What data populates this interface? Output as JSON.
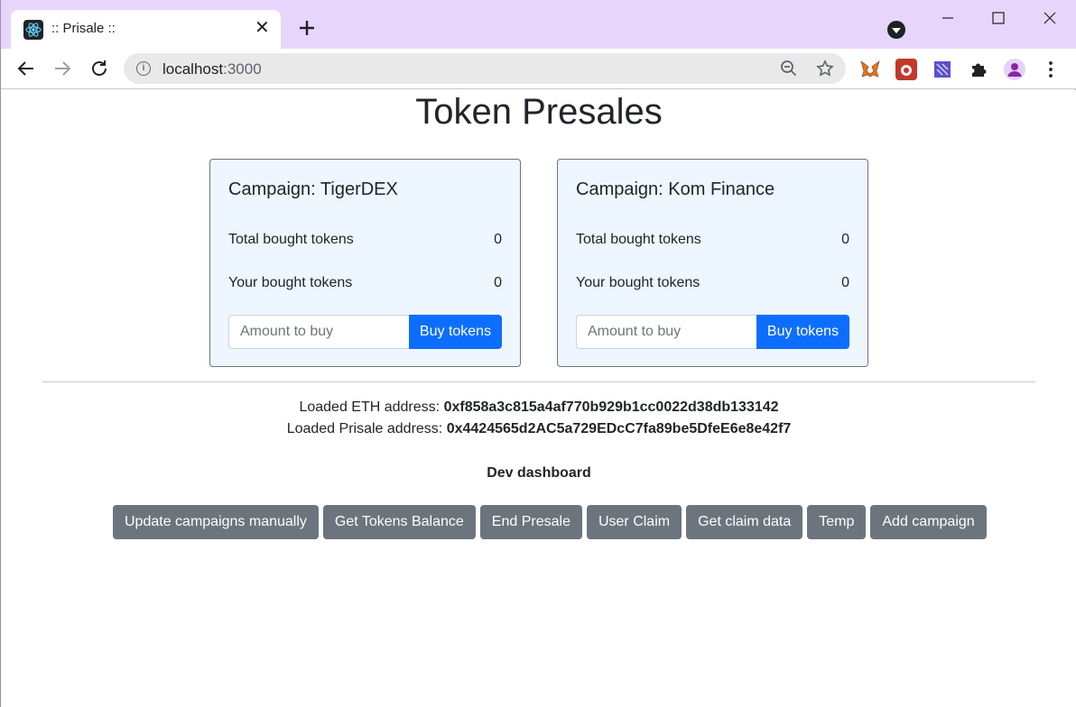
{
  "browser": {
    "tab_title": ":: Prisale ::",
    "url_host": "localhost",
    "url_port": ":3000",
    "colors": {
      "tabstrip": "#e8d5fb",
      "omnibox": "#e9e9ea"
    }
  },
  "page": {
    "title": "Token Presales",
    "campaigns": [
      {
        "title": "Campaign: TigerDEX",
        "total_label": "Total bought tokens",
        "total_value": "0",
        "yours_label": "Your bought tokens",
        "yours_value": "0",
        "input_placeholder": "Amount to buy",
        "buy_label": "Buy tokens"
      },
      {
        "title": "Campaign: Kom Finance",
        "total_label": "Total bought tokens",
        "total_value": "0",
        "yours_label": "Your bought tokens",
        "yours_value": "0",
        "input_placeholder": "Amount to buy",
        "buy_label": "Buy tokens"
      }
    ],
    "eth_address_label": "Loaded ETH address:",
    "eth_address": "0xf858a3c815a4af770b929b1cc0022d38db133142",
    "presale_address_label": "Loaded Prisale address:",
    "presale_address": "0x4424565d2AC5a729EDcC7fa89be5DfeE6e8e42f7",
    "dev_dashboard_title": "Dev dashboard",
    "dev_buttons": [
      "Update campaigns manually",
      "Get Tokens Balance",
      "End Presale",
      "User Claim",
      "Get claim data",
      "Temp",
      "Add campaign"
    ],
    "colors": {
      "primary": "#0d6efd",
      "secondary": "#6c757d",
      "card_bg": "#eef6ff"
    }
  }
}
